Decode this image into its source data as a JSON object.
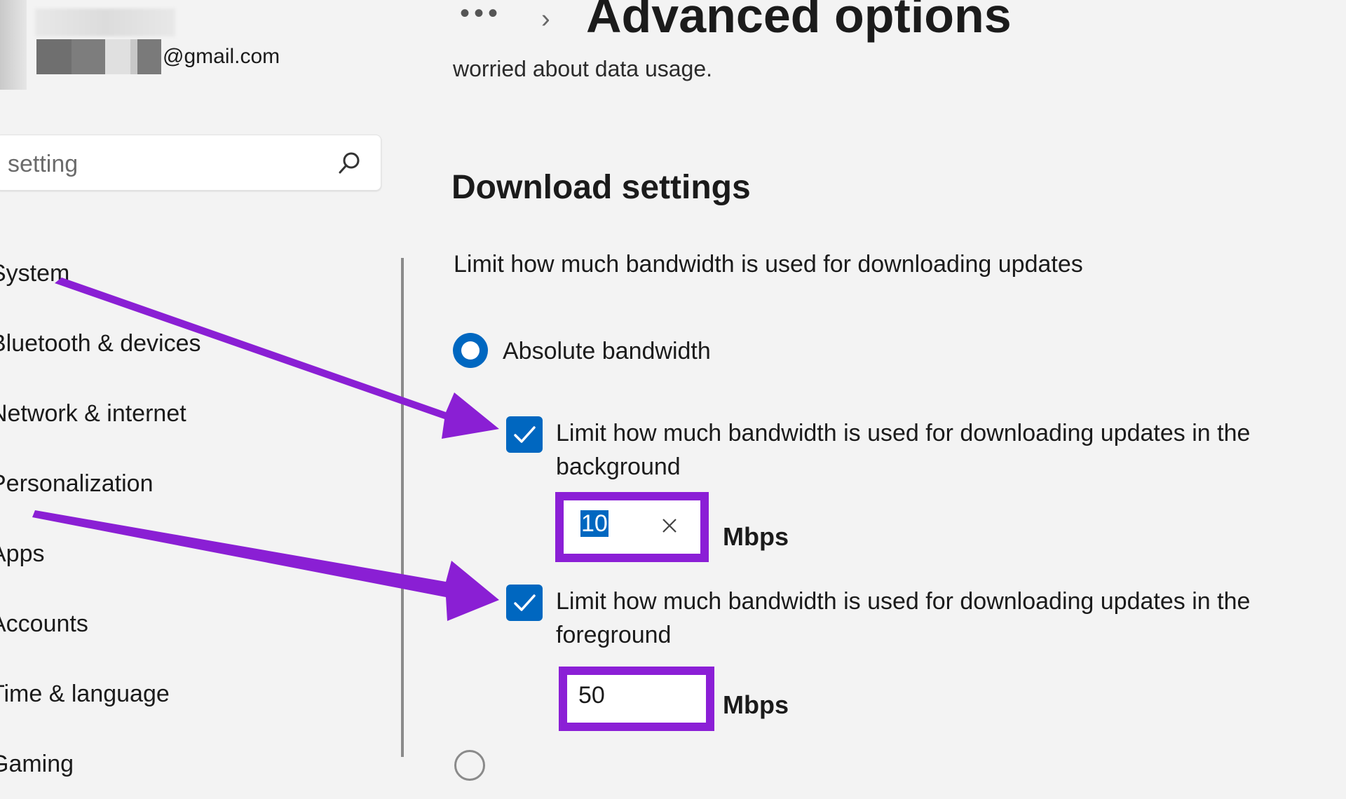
{
  "account": {
    "email_suffix": "@gmail.com"
  },
  "search": {
    "placeholder": "setting",
    "icon": "search-icon"
  },
  "sidebar": {
    "items": [
      {
        "label": "System"
      },
      {
        "label": "Bluetooth & devices"
      },
      {
        "label": "Network & internet"
      },
      {
        "label": "Personalization"
      },
      {
        "label": "Apps"
      },
      {
        "label": "Accounts"
      },
      {
        "label": "Time & language"
      },
      {
        "label": "Gaming"
      }
    ]
  },
  "header": {
    "more_glyph": "•••",
    "chevron": "›",
    "title": "Advanced options"
  },
  "main": {
    "clipped_line": "worried about data usage.",
    "section_title": "Download settings",
    "section_desc": "Limit how much bandwidth is used for downloading updates",
    "absolute_option": {
      "label": "Absolute bandwidth",
      "selected": true
    },
    "background_limit": {
      "checked": true,
      "label": "Limit how much bandwidth is used for downloading updates in the background",
      "value": "10",
      "unit": "Mbps"
    },
    "foreground_limit": {
      "checked": true,
      "label": "Limit how much bandwidth is used for downloading updates in the foreground",
      "value": "50",
      "unit": "Mbps"
    }
  },
  "colors": {
    "accent": "#0067c0",
    "highlight": "#8b1fd6",
    "background": "#f3f3f3"
  }
}
